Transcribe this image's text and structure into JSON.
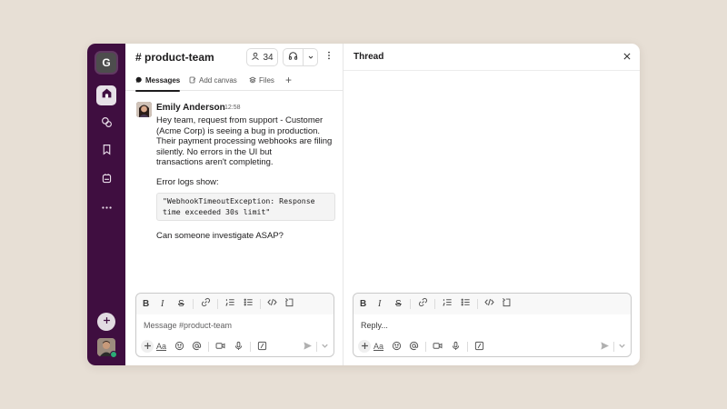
{
  "workspace": {
    "initial": "G"
  },
  "rail": {
    "items": [
      {
        "name": "home",
        "icon": "home-icon"
      },
      {
        "name": "dms",
        "icon": "dm-icon"
      },
      {
        "name": "later",
        "icon": "bookmark-icon"
      },
      {
        "name": "activity",
        "icon": "activity-icon"
      },
      {
        "name": "more",
        "icon": "more-icon"
      }
    ],
    "add_icon": "plus-icon"
  },
  "channel": {
    "title": "# product-team",
    "member_count": "34",
    "tabs": [
      {
        "label": "Messages",
        "icon": "message-bubble-icon"
      },
      {
        "label": "Add canvas",
        "icon": "canvas-icon"
      },
      {
        "label": "Files",
        "icon": "files-icon"
      }
    ],
    "tab_plus": "+"
  },
  "message": {
    "author": "Emily Anderson",
    "time": "12:58",
    "paragraph1": "Hey team, request from support - Customer\n(Acme Corp) is seeing a bug in production.\nTheir payment processing webhooks are filing\nsilently. No errors in the UI but\ntransactions aren't completing.",
    "paragraph2": "Error logs show:",
    "code": "\"WebhookTimeoutException: Response\ntime exceeded 30s limit\"",
    "paragraph3": "Can someone investigate ASAP?"
  },
  "composer": {
    "placeholder": "Message #product-team",
    "toolbar": {
      "bold": "B",
      "italic": "I",
      "strike": "S"
    },
    "aa": "Aa"
  },
  "thread": {
    "title": "Thread",
    "reply_placeholder": "Reply...",
    "aa": "Aa"
  },
  "colors": {
    "background": "#e7dfd5",
    "sidebar": "#3f0e40",
    "presence": "#2bac76"
  }
}
